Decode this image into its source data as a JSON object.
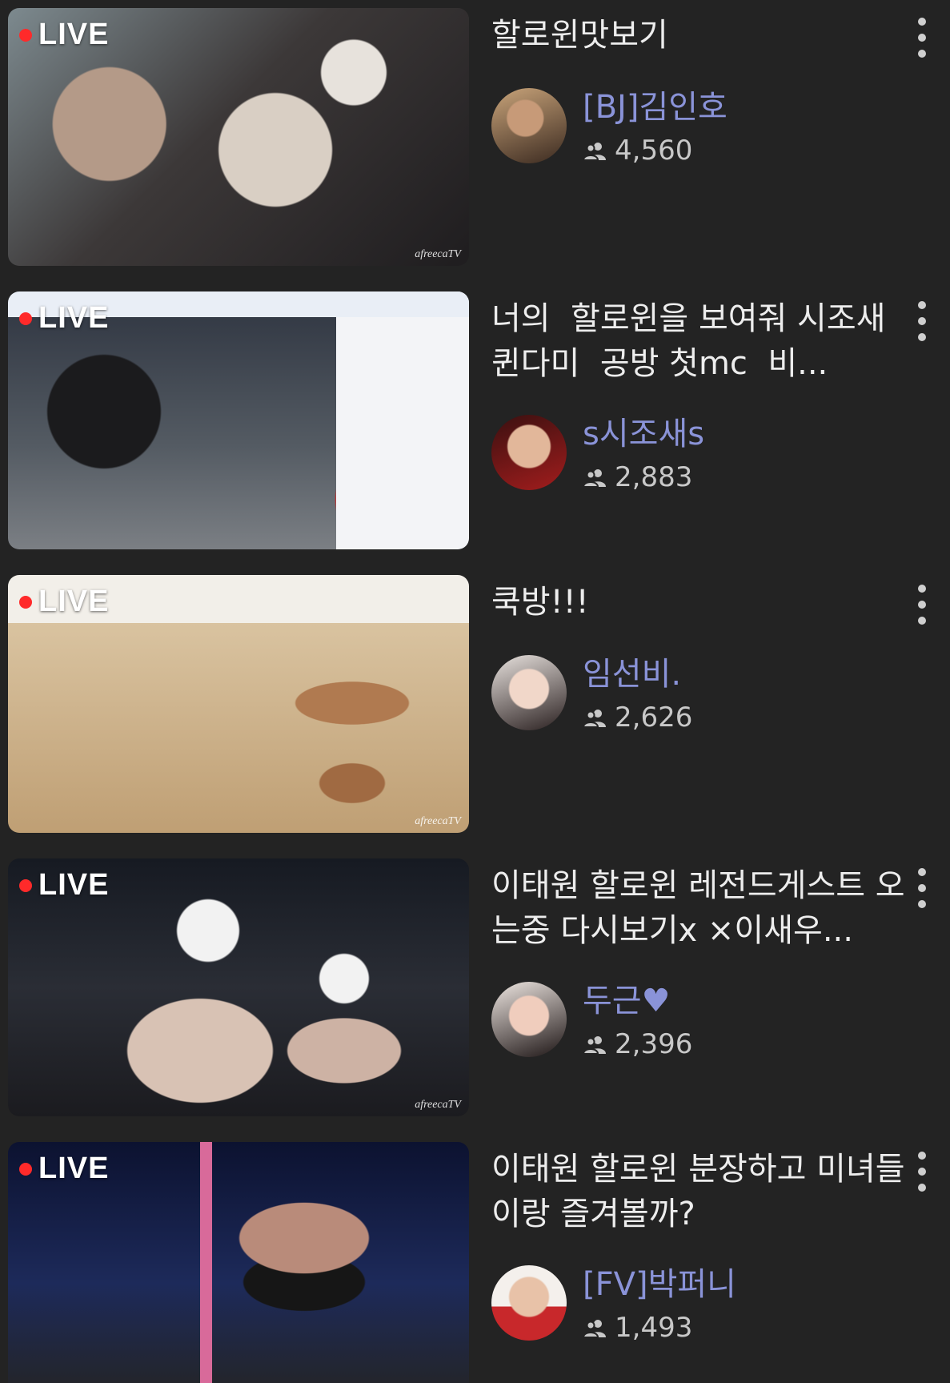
{
  "live_label": "LIVE",
  "watermark": "afreecaTV",
  "streams": [
    {
      "title": "할로윈맛보기",
      "channel": "[BJ]김인호",
      "viewers": "4,560",
      "thumb_colors": [
        "#8b8f94",
        "#2e2a2a",
        "#c9b8a8"
      ]
    },
    {
      "title": "너의  할로윈을 보여줘 시조새 퀸다미  공방 첫mc  비...",
      "channel": "s시조새s",
      "viewers": "2,883",
      "thumb_colors": [
        "#e8eef7",
        "#3a3f4a",
        "#d23b3b"
      ]
    },
    {
      "title": "쿡방!!!",
      "channel": "임선비.",
      "viewers": "2,626",
      "thumb_colors": [
        "#c8ab85",
        "#f0ede8",
        "#a0704a"
      ]
    },
    {
      "title": "이태원 할로윈 레전드게스트 오는중 다시보기x ×이새우...",
      "channel": "두근♥",
      "viewers": "2,396",
      "thumb_colors": [
        "#1c1f26",
        "#e8e4e0",
        "#5a4a44"
      ]
    },
    {
      "title": "이태원 할로윈 분장하고 미녀들이랑 즐겨볼까?",
      "channel": "[FV]박퍼니",
      "viewers": "1,493",
      "thumb_colors": [
        "#0f1630",
        "#d86a9a",
        "#2a2a2a"
      ]
    }
  ]
}
